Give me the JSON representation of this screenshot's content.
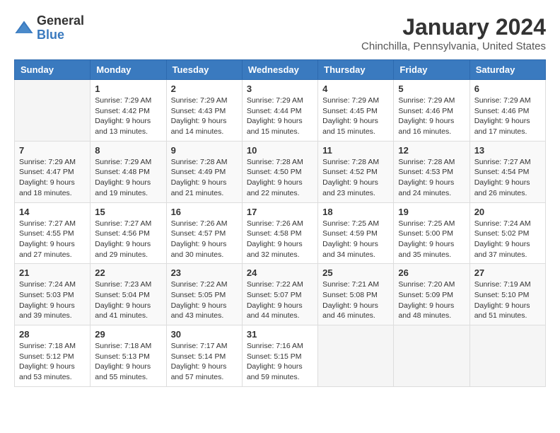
{
  "logo": {
    "general": "General",
    "blue": "Blue"
  },
  "title": "January 2024",
  "subtitle": "Chinchilla, Pennsylvania, United States",
  "days_header": [
    "Sunday",
    "Monday",
    "Tuesday",
    "Wednesday",
    "Thursday",
    "Friday",
    "Saturday"
  ],
  "weeks": [
    [
      {
        "day": "",
        "info": ""
      },
      {
        "day": "1",
        "info": "Sunrise: 7:29 AM\nSunset: 4:42 PM\nDaylight: 9 hours\nand 13 minutes."
      },
      {
        "day": "2",
        "info": "Sunrise: 7:29 AM\nSunset: 4:43 PM\nDaylight: 9 hours\nand 14 minutes."
      },
      {
        "day": "3",
        "info": "Sunrise: 7:29 AM\nSunset: 4:44 PM\nDaylight: 9 hours\nand 15 minutes."
      },
      {
        "day": "4",
        "info": "Sunrise: 7:29 AM\nSunset: 4:45 PM\nDaylight: 9 hours\nand 15 minutes."
      },
      {
        "day": "5",
        "info": "Sunrise: 7:29 AM\nSunset: 4:46 PM\nDaylight: 9 hours\nand 16 minutes."
      },
      {
        "day": "6",
        "info": "Sunrise: 7:29 AM\nSunset: 4:46 PM\nDaylight: 9 hours\nand 17 minutes."
      }
    ],
    [
      {
        "day": "7",
        "info": "Sunrise: 7:29 AM\nSunset: 4:47 PM\nDaylight: 9 hours\nand 18 minutes."
      },
      {
        "day": "8",
        "info": "Sunrise: 7:29 AM\nSunset: 4:48 PM\nDaylight: 9 hours\nand 19 minutes."
      },
      {
        "day": "9",
        "info": "Sunrise: 7:28 AM\nSunset: 4:49 PM\nDaylight: 9 hours\nand 21 minutes."
      },
      {
        "day": "10",
        "info": "Sunrise: 7:28 AM\nSunset: 4:50 PM\nDaylight: 9 hours\nand 22 minutes."
      },
      {
        "day": "11",
        "info": "Sunrise: 7:28 AM\nSunset: 4:52 PM\nDaylight: 9 hours\nand 23 minutes."
      },
      {
        "day": "12",
        "info": "Sunrise: 7:28 AM\nSunset: 4:53 PM\nDaylight: 9 hours\nand 24 minutes."
      },
      {
        "day": "13",
        "info": "Sunrise: 7:27 AM\nSunset: 4:54 PM\nDaylight: 9 hours\nand 26 minutes."
      }
    ],
    [
      {
        "day": "14",
        "info": "Sunrise: 7:27 AM\nSunset: 4:55 PM\nDaylight: 9 hours\nand 27 minutes."
      },
      {
        "day": "15",
        "info": "Sunrise: 7:27 AM\nSunset: 4:56 PM\nDaylight: 9 hours\nand 29 minutes."
      },
      {
        "day": "16",
        "info": "Sunrise: 7:26 AM\nSunset: 4:57 PM\nDaylight: 9 hours\nand 30 minutes."
      },
      {
        "day": "17",
        "info": "Sunrise: 7:26 AM\nSunset: 4:58 PM\nDaylight: 9 hours\nand 32 minutes."
      },
      {
        "day": "18",
        "info": "Sunrise: 7:25 AM\nSunset: 4:59 PM\nDaylight: 9 hours\nand 34 minutes."
      },
      {
        "day": "19",
        "info": "Sunrise: 7:25 AM\nSunset: 5:00 PM\nDaylight: 9 hours\nand 35 minutes."
      },
      {
        "day": "20",
        "info": "Sunrise: 7:24 AM\nSunset: 5:02 PM\nDaylight: 9 hours\nand 37 minutes."
      }
    ],
    [
      {
        "day": "21",
        "info": "Sunrise: 7:24 AM\nSunset: 5:03 PM\nDaylight: 9 hours\nand 39 minutes."
      },
      {
        "day": "22",
        "info": "Sunrise: 7:23 AM\nSunset: 5:04 PM\nDaylight: 9 hours\nand 41 minutes."
      },
      {
        "day": "23",
        "info": "Sunrise: 7:22 AM\nSunset: 5:05 PM\nDaylight: 9 hours\nand 43 minutes."
      },
      {
        "day": "24",
        "info": "Sunrise: 7:22 AM\nSunset: 5:07 PM\nDaylight: 9 hours\nand 44 minutes."
      },
      {
        "day": "25",
        "info": "Sunrise: 7:21 AM\nSunset: 5:08 PM\nDaylight: 9 hours\nand 46 minutes."
      },
      {
        "day": "26",
        "info": "Sunrise: 7:20 AM\nSunset: 5:09 PM\nDaylight: 9 hours\nand 48 minutes."
      },
      {
        "day": "27",
        "info": "Sunrise: 7:19 AM\nSunset: 5:10 PM\nDaylight: 9 hours\nand 51 minutes."
      }
    ],
    [
      {
        "day": "28",
        "info": "Sunrise: 7:18 AM\nSunset: 5:12 PM\nDaylight: 9 hours\nand 53 minutes."
      },
      {
        "day": "29",
        "info": "Sunrise: 7:18 AM\nSunset: 5:13 PM\nDaylight: 9 hours\nand 55 minutes."
      },
      {
        "day": "30",
        "info": "Sunrise: 7:17 AM\nSunset: 5:14 PM\nDaylight: 9 hours\nand 57 minutes."
      },
      {
        "day": "31",
        "info": "Sunrise: 7:16 AM\nSunset: 5:15 PM\nDaylight: 9 hours\nand 59 minutes."
      },
      {
        "day": "",
        "info": ""
      },
      {
        "day": "",
        "info": ""
      },
      {
        "day": "",
        "info": ""
      }
    ]
  ]
}
